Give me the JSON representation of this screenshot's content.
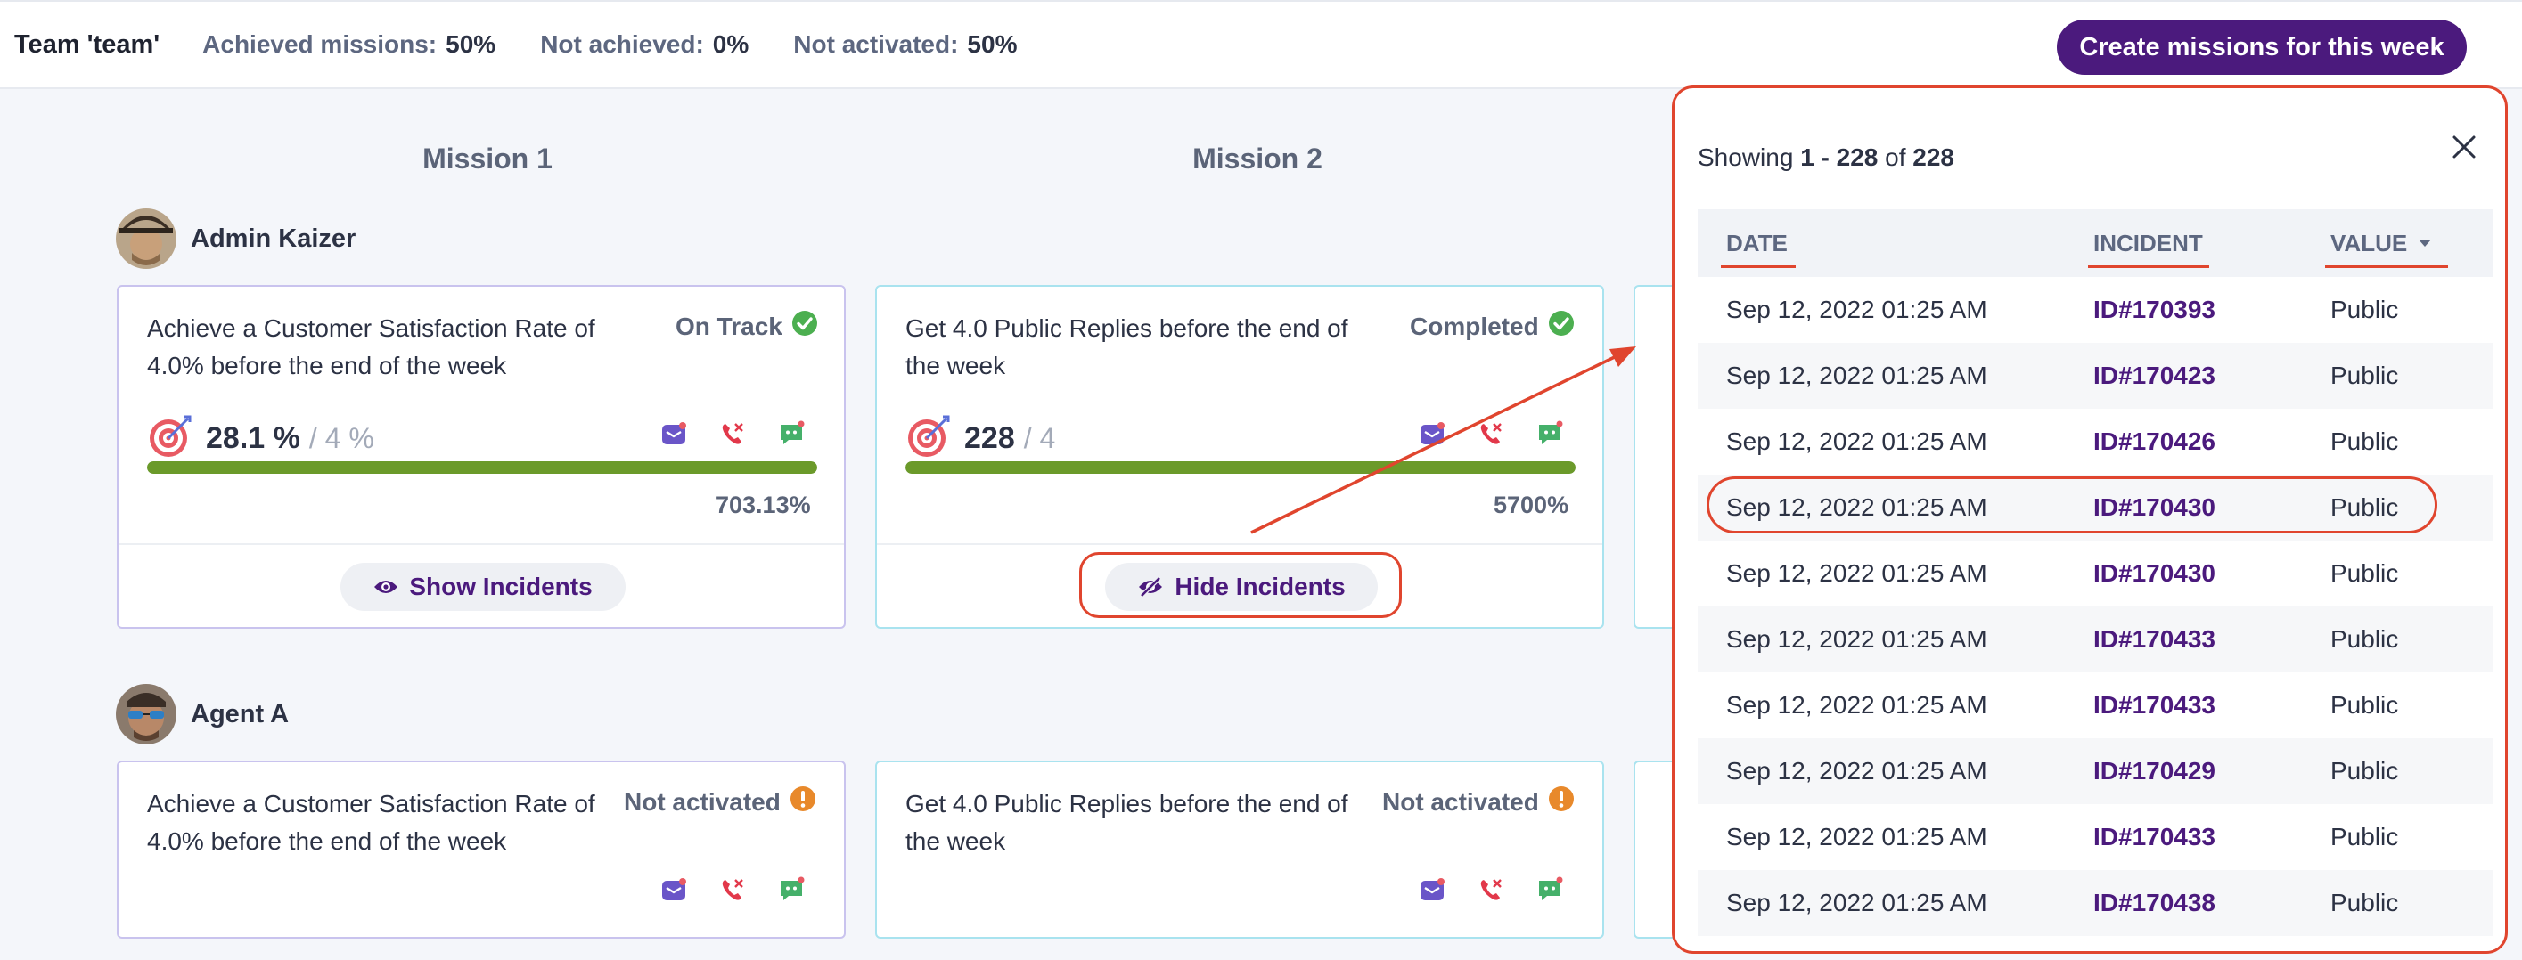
{
  "header": {
    "team": "Team 'team'",
    "stats": [
      {
        "label": "Achieved missions:",
        "value": "50%"
      },
      {
        "label": "Not achieved:",
        "value": "0%"
      },
      {
        "label": "Not activated:",
        "value": "50%"
      }
    ],
    "create_button": "Create missions for this week"
  },
  "columns": [
    "Mission 1",
    "Mission 2"
  ],
  "users": [
    {
      "name": "Admin Kaizer",
      "missions": [
        {
          "title": "Achieve a Customer Satisfaction Rate of 4.0% before the end of the week",
          "status": "On Track",
          "value": "28.1 %",
          "target": "/ 4 %",
          "progress_fraction": 1.0,
          "percent": "703.13%",
          "button": "Show Incidents"
        },
        {
          "title": "Get 4.0 Public Replies before the end of the week",
          "status": "Completed",
          "value": "228",
          "target": "/ 4",
          "progress_fraction": 1.0,
          "percent": "5700%",
          "button": "Hide Incidents"
        }
      ]
    },
    {
      "name": "Agent A",
      "missions": [
        {
          "title": "Achieve a Customer Satisfaction Rate of 4.0% before the end of the week",
          "status": "Not activated"
        },
        {
          "title": "Get 4.0 Public Replies before the end of the week",
          "status": "Not activated"
        }
      ]
    }
  ],
  "incidents": {
    "showing_prefix": "Showing",
    "range": "1 - 228",
    "of": "of",
    "total": "228",
    "headers": {
      "date": "DATE",
      "incident": "INCIDENT",
      "value": "VALUE"
    },
    "rows": [
      {
        "date": "Sep 12, 2022 01:25 AM",
        "id": "ID#170393",
        "value": "Public"
      },
      {
        "date": "Sep 12, 2022 01:25 AM",
        "id": "ID#170423",
        "value": "Public"
      },
      {
        "date": "Sep 12, 2022 01:25 AM",
        "id": "ID#170426",
        "value": "Public"
      },
      {
        "date": "Sep 12, 2022 01:25 AM",
        "id": "ID#170430",
        "value": "Public"
      },
      {
        "date": "Sep 12, 2022 01:25 AM",
        "id": "ID#170430",
        "value": "Public"
      },
      {
        "date": "Sep 12, 2022 01:25 AM",
        "id": "ID#170433",
        "value": "Public"
      },
      {
        "date": "Sep 12, 2022 01:25 AM",
        "id": "ID#170433",
        "value": "Public"
      },
      {
        "date": "Sep 12, 2022 01:25 AM",
        "id": "ID#170429",
        "value": "Public"
      },
      {
        "date": "Sep 12, 2022 01:25 AM",
        "id": "ID#170433",
        "value": "Public"
      },
      {
        "date": "Sep 12, 2022 01:25 AM",
        "id": "ID#170438",
        "value": "Public"
      }
    ]
  },
  "colors": {
    "brand_purple": "#4b1a7d",
    "progress_green": "#6b9a2a",
    "status_green": "#4caf50",
    "status_orange": "#e8892b",
    "annotation_red": "#e0452e"
  },
  "icons": [
    "target-icon",
    "email-channel-icon",
    "phone-channel-icon",
    "chat-channel-icon",
    "check-circle-icon",
    "alert-circle-icon",
    "eye-icon",
    "eye-off-icon",
    "close-icon",
    "sort-desc-icon"
  ]
}
